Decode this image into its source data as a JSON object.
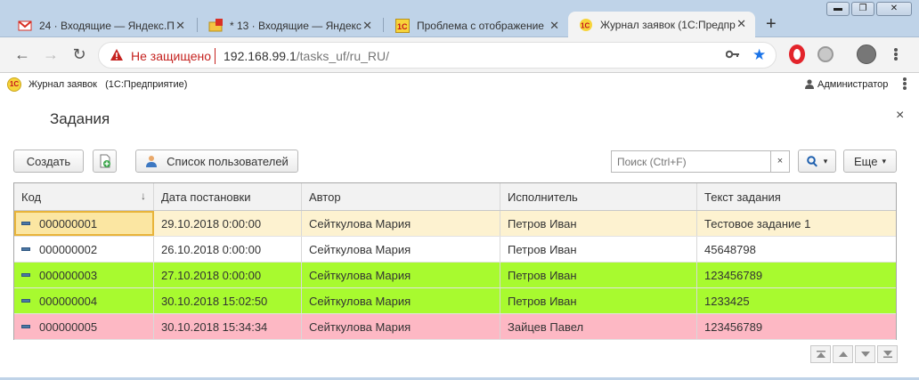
{
  "browser": {
    "tabs": [
      {
        "label": "24 · Входящие — Яндекс.П",
        "icon": "yandex-mail-icon"
      },
      {
        "label": "* 13 · Входящие — Яндекс",
        "icon": "yandex-mail-icon",
        "badge": "1"
      },
      {
        "label": "Проблема с отображение",
        "icon": "1c-icon"
      },
      {
        "label": "Журнал заявок (1С:Предпр",
        "icon": "1c-icon",
        "active": true
      }
    ],
    "new_tab": "+",
    "window_buttons": [
      "▬",
      "❐",
      "✕"
    ],
    "security_label": "Не защищено",
    "url_host": "192.168.99.1",
    "url_path": "/tasks_uf/ru_RU/"
  },
  "app": {
    "logo": "1С",
    "title": "Журнал заявок",
    "platform": "(1С:Предприятие)",
    "user": "Администратор"
  },
  "form": {
    "title": "Задания",
    "close": "×",
    "create_button": "Создать",
    "users_button": "Список пользователей",
    "search_placeholder": "Поиск (Ctrl+F)",
    "search_clear": "×",
    "more_button": "Еще",
    "more_arrow": "▾",
    "search_arrow": "▾"
  },
  "table": {
    "columns": [
      "Код",
      "Дата постановки",
      "Автор",
      "Исполнитель",
      "Текст задания"
    ],
    "sort_indicator": "↓",
    "rows": [
      {
        "code": "000000001",
        "date": "29.10.2018 0:00:00",
        "author": "Сейткулова Мария",
        "executor": "Петров Иван",
        "text": "Тестовое задание 1",
        "color": "#fdf2d0",
        "selected": true
      },
      {
        "code": "000000002",
        "date": "26.10.2018 0:00:00",
        "author": "Сейткулова Мария",
        "executor": "Петров Иван",
        "text": "45648798",
        "color": "#ffffff"
      },
      {
        "code": "000000003",
        "date": "27.10.2018 0:00:00",
        "author": "Сейткулова Мария",
        "executor": "Петров Иван",
        "text": "123456789",
        "color": "#a8fa2f"
      },
      {
        "code": "000000004",
        "date": "30.10.2018 15:02:50",
        "author": "Сейткулова Мария",
        "executor": "Петров Иван",
        "text": "1233425",
        "color": "#a8fa2f"
      },
      {
        "code": "000000005",
        "date": "30.10.2018 15:34:34",
        "author": "Сейткулова Мария",
        "executor": "Зайцев Павел",
        "text": "123456789",
        "color": "#fdb8c4"
      }
    ]
  },
  "colors": {
    "tabstrip": "#bfd3e8",
    "insecure": "#c5221f",
    "row_green": "#a8fa2f",
    "row_pink": "#fdb8c4",
    "row_selected": "#fdf2d0"
  }
}
